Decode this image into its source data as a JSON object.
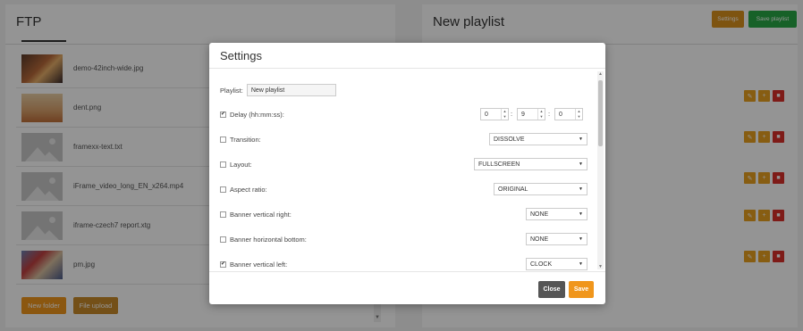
{
  "left_panel": {
    "title": "FTP",
    "files": [
      {
        "name": "demo-42inch-wide.jpg",
        "thumb": "photo"
      },
      {
        "name": "dent.png",
        "thumb": "photo"
      },
      {
        "name": "framexx-text.txt",
        "thumb": "placeholder"
      },
      {
        "name": "iFrame_video_long_EN_x264.mp4",
        "thumb": "placeholder"
      },
      {
        "name": "iframe-czech7 report.xtg",
        "thumb": "placeholder"
      },
      {
        "name": "pm.jpg",
        "thumb": "photo"
      }
    ],
    "new_folder_label": "New folder",
    "file_upload_label": "File upload"
  },
  "right_panel": {
    "title": "New playlist",
    "settings_label": "Settings",
    "save_playlist_label": "Save playlist",
    "action_rows": 5,
    "action_icons": [
      "pencil-icon",
      "plus-icon",
      "trash-icon"
    ],
    "action_glyphs": {
      "edit": "✎",
      "add": "+",
      "delete": "■"
    }
  },
  "modal": {
    "title": "Settings",
    "playlist_label": "Playlist:",
    "playlist_value": "New playlist",
    "delay": {
      "label": "Delay (hh:mm:ss):",
      "checked": true,
      "hh": "0",
      "mm": "9",
      "ss": "0"
    },
    "transition": {
      "label": "Transition:",
      "checked": false,
      "value": "DISSOLVE"
    },
    "layout": {
      "label": "Layout:",
      "checked": false,
      "value": "FULLSCREEN"
    },
    "aspect_ratio": {
      "label": "Aspect ratio:",
      "checked": false,
      "value": "ORIGINAL"
    },
    "banner_vertical_right": {
      "label": "Banner vertical right:",
      "checked": false,
      "value": "NONE"
    },
    "banner_horizontal_bottom": {
      "label": "Banner horizontal bottom:",
      "checked": false,
      "value": "NONE"
    },
    "banner_vertical_left": {
      "label": "Banner vertical left:",
      "checked": true,
      "value": "CLOCK"
    },
    "close_label": "Close",
    "save_label": "Save"
  },
  "colors": {
    "orange": "#f0961c",
    "green": "#28a745",
    "red": "#d9302a",
    "dark_gray": "#555555"
  }
}
